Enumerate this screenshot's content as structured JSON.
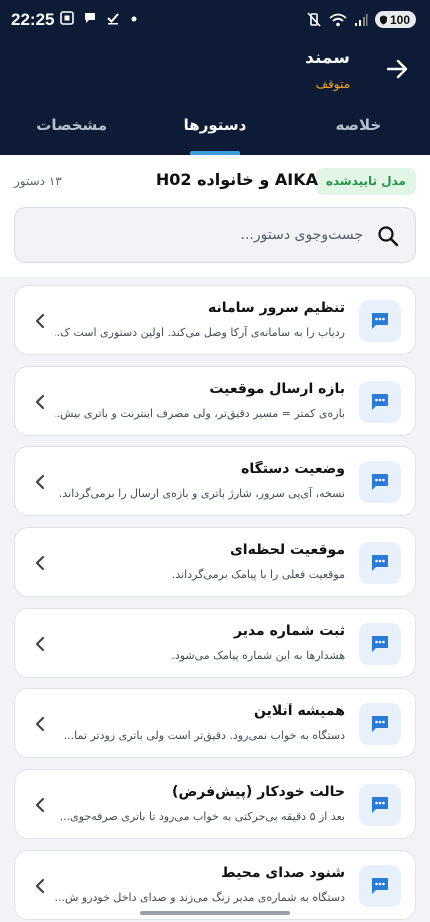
{
  "status_bar": {
    "time": "22:25",
    "battery": "100"
  },
  "header": {
    "title": "سمند",
    "status": "متوقف",
    "back_icon": "arrow-right-icon"
  },
  "tabs": [
    {
      "label": "خلاصه",
      "active": false
    },
    {
      "label": "دستورها",
      "active": true
    },
    {
      "label": "مشخصات",
      "active": false
    }
  ],
  "info": {
    "verified_badge": "مدل تاییدشده",
    "device_title": "AIKA و خانواده H02",
    "command_count": "۱۳ دستور"
  },
  "search": {
    "placeholder": "جست‌وجوی دستور..."
  },
  "commands": [
    {
      "title": "تنظیم سرور سامانه",
      "description": "ردیاب را به سامانه‌ی آرکا وصل می‌کند. اولین دستوری است ک..."
    },
    {
      "title": "بازه ارسال موقعیت",
      "description": "بازه‌ی کمتر = مسیر دقیق‌تر، ولی مصرف اینترنت و باتری بیش..."
    },
    {
      "title": "وضعیت دستگاه",
      "description": "نسخه، آی‌پی سرور، شارژ باتری و بازه‌ی ارسال را برمی‌گرداند."
    },
    {
      "title": "موقعیت لحظه‌ای",
      "description": "موقعیت فعلی را با پیامک برمی‌گرداند."
    },
    {
      "title": "ثبت شماره مدیر",
      "description": "هشدارها به این شماره پیامک می‌شود."
    },
    {
      "title": "همیشه آنلاین",
      "description": "دستگاه به خواب نمی‌رود. دقیق‌تر است ولی باتری زودتر تما..."
    },
    {
      "title": "حالت خودکار (پیش‌فرض)",
      "description": "بعد از ۵ دقیقه بی‌حرکتی به خواب می‌رود تا باتری صرفه‌جوی..."
    },
    {
      "title": "شنود صدای محیط",
      "description": "دستگاه به شماره‌ی مدیر زنگ می‌زند و صدای داخل خودرو ش..."
    }
  ],
  "colors": {
    "header_bg": "#0d1b36",
    "accent": "#3c9bd9",
    "status_orange": "#f5a623",
    "verified_green": "#27944a"
  }
}
